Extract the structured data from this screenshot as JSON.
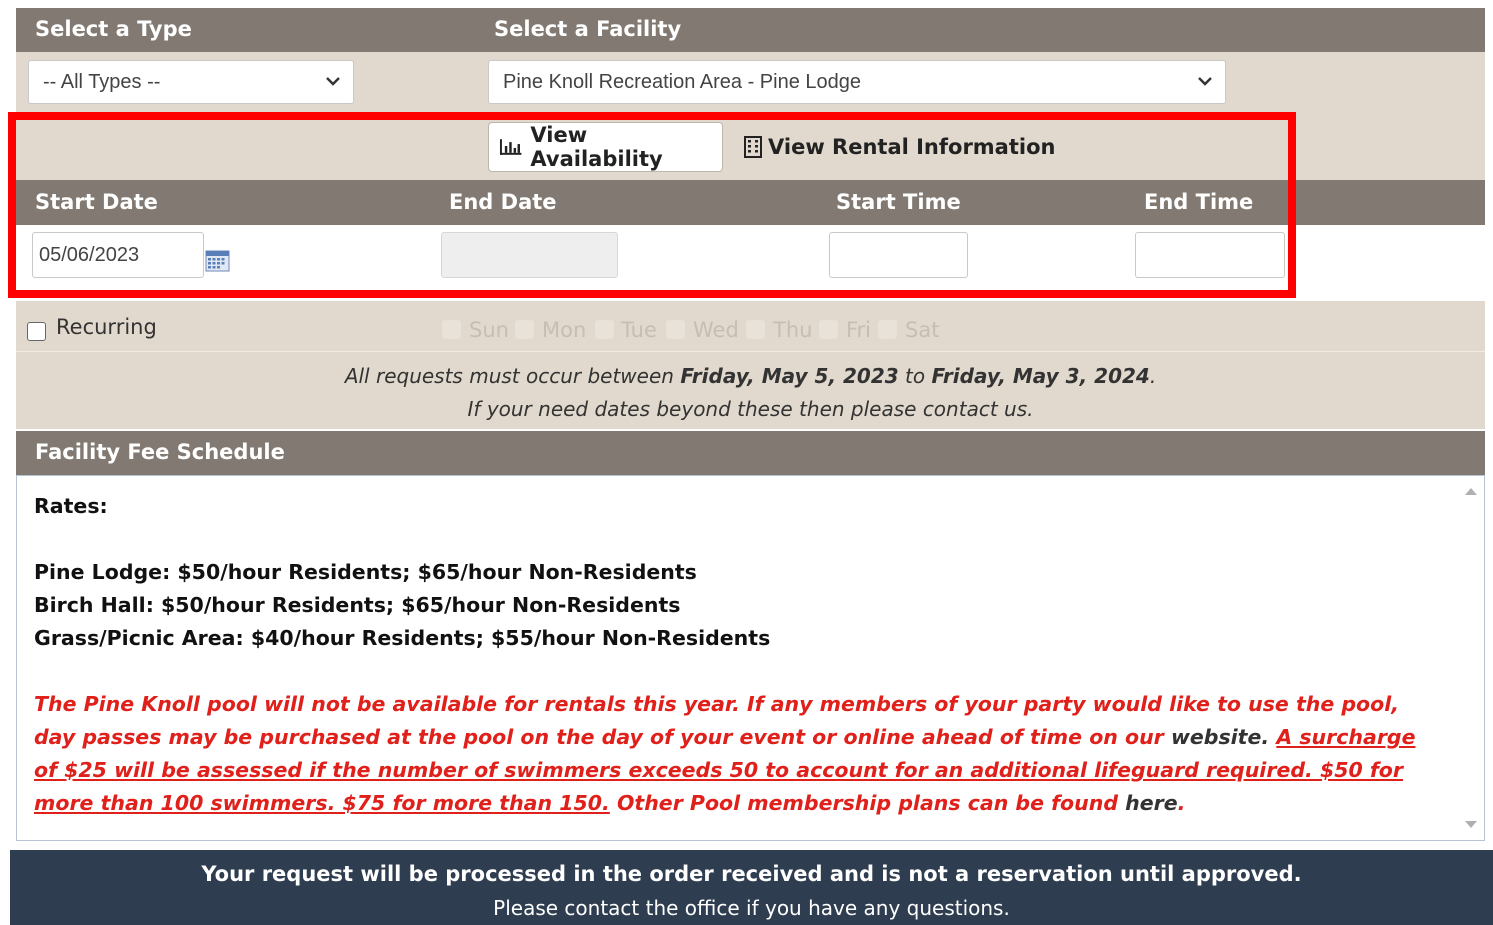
{
  "type_section": {
    "type_header": "Select a Type",
    "facility_header": "Select a Facility",
    "type_selected": "-- All Types --",
    "facility_selected": "Pine Knoll Recreation Area - Pine Lodge"
  },
  "actions": {
    "view_availability": "View Availability",
    "view_rental_info": "View Rental Information"
  },
  "dates": {
    "start_date_label": "Start Date",
    "end_date_label": "End Date",
    "start_time_label": "Start Time",
    "end_time_label": "End Time",
    "start_date_value": "05/06/2023",
    "end_date_value": "",
    "start_time_value": "",
    "end_time_value": ""
  },
  "recurring": {
    "label": "Recurring",
    "days": [
      "Sun",
      "Mon",
      "Tue",
      "Wed",
      "Thu",
      "Fri",
      "Sat"
    ]
  },
  "notice": {
    "prefix": "All requests must occur between ",
    "start": "Friday, May 5, 2023",
    "mid": " to ",
    "end": "Friday, May 3, 2024",
    "suffix": ".",
    "line2_prefix": "If your need dates beyond these then please ",
    "contact_link": "contact us",
    "line2_suffix": "."
  },
  "fee_schedule": {
    "header": "Facility Fee Schedule",
    "rates_label": "Rates:",
    "rates": [
      "Pine Lodge: $50/hour Residents; $65/hour Non-Residents",
      "Birch Hall: $50/hour Residents; $65/hour Non-Residents",
      "Grass/Picnic Area: $40/hour Residents; $55/hour Non-Residents"
    ],
    "pool_text_1": "The Pine Knoll pool will not be available for rentals this year. If any members of your party would like to use the pool, day passes may be purchased at the pool on the day of your event or online ahead of time on our ",
    "website_link": "website",
    "pool_text_2": ". ",
    "surcharge_text": "A surcharge of $25 will be assessed if the number of swimmers exceeds 50 to account for an additional lifeguard required. $50 for more than 100 swimmers. $75 for more than 150.",
    "pool_text_3": " Other Pool membership plans can be found ",
    "here_link": "here",
    "pool_text_4": "."
  },
  "footer": {
    "line1": "Your request will be processed in the order received and is not a reservation until approved.",
    "line2": "Please contact the office if you have any questions."
  },
  "colors": {
    "header_bar": "#827a72",
    "panel": "#e1d9cd",
    "highlight": "#ff0000",
    "footer": "#2e3d4f",
    "alert_text": "#e0201a"
  }
}
